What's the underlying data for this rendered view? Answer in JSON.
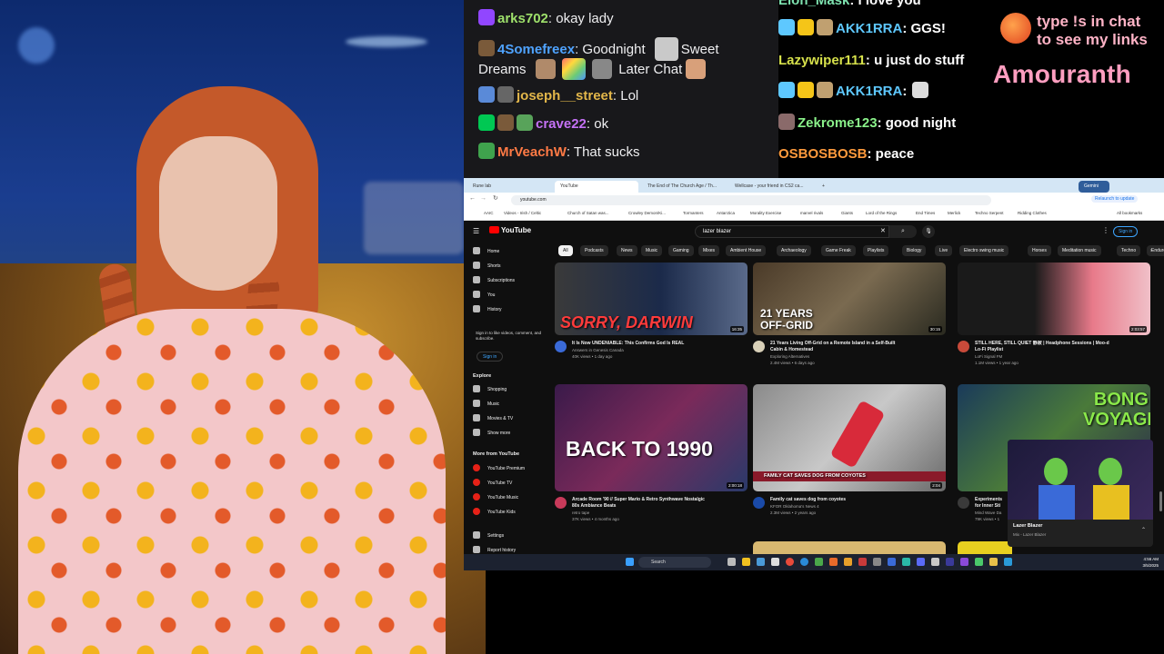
{
  "chat_left": [
    {
      "user": "arks702",
      "text": ": okay lady",
      "color": "#9ee06b"
    },
    {
      "user": "4Somefreex",
      "text": ": Goodnight",
      "extra": "Sweet",
      "color": "#4fa3ff"
    },
    {
      "line": "Dreams",
      "after": "Later Chat"
    },
    {
      "user": "joseph__street",
      "text": ": Lol",
      "color": "#e2b64a"
    },
    {
      "user": "crave22",
      "text": ": ok",
      "color": "#c471f5"
    },
    {
      "user": "MrVeachW",
      "text": ": That sucks",
      "color": "#ff7a45"
    }
  ],
  "chat_right": [
    {
      "user": "Elon_Mask",
      "text": ": i love you",
      "color": "#7ee3b0"
    },
    {
      "user": "AKK1RRA",
      "text": ": GGS!",
      "color": "#5ec8ff"
    },
    {
      "user": "Lazywiper111",
      "text": ": u just do stuff",
      "color": "#d6e04b"
    },
    {
      "user": "AKK1RRA",
      "text": ":",
      "color": "#5ec8ff"
    },
    {
      "user": "Zekrome123",
      "text": ": good night",
      "color": "#8af28a"
    },
    {
      "user": "OSBOSBOSB",
      "text": ": peace",
      "color": "#ff9a3c"
    }
  ],
  "promo": {
    "line1": "type !s in chat",
    "line2": "to see my links",
    "name": "Amouranth"
  },
  "browser": {
    "tabs": [
      "Rune lab",
      "YouTube",
      "The End of The Church Age / Th...",
      "Wellcase - your friend in CS2 ca..."
    ],
    "url": "youtube.com",
    "bookmarks": [
      "AAIC",
      "Videos - Irish / Celtic",
      "Church of Satan was...",
      "Crowley Demon/Ki...",
      "Tormanters",
      "Antarctica",
      "Morality Exercise",
      "marvel rivals",
      "Giants",
      "Lord of the Rings",
      "End Times",
      "Merlick",
      "Techno Serpent",
      "Ridding Clothes",
      "All bookmarks"
    ],
    "tab_extra": "Gemini",
    "update_label": "Relaunch to update"
  },
  "youtube": {
    "logo": "YouTube",
    "search_value": "lazer blazer",
    "signin": "Sign in",
    "chips": [
      "All",
      "Podcasts",
      "News",
      "Music",
      "Gaming",
      "Mixes",
      "Ambient House",
      "Archaeology",
      "Game Freak",
      "Playlists",
      "Biology",
      "Live",
      "Electro swing music",
      "Horses",
      "Meditation music",
      "Techno",
      "Enduro"
    ],
    "sidebar": {
      "main": [
        "Home",
        "Shorts",
        "Subscriptions",
        "You",
        "History"
      ],
      "note": "Sign in to like videos, comment, and subscribe.",
      "signin": "Sign in",
      "explore_head": "Explore",
      "explore": [
        "Shopping",
        "Music",
        "Movies & TV",
        "Show more"
      ],
      "more_head": "More from YouTube",
      "more": [
        "YouTube Premium",
        "YouTube TV",
        "YouTube Music",
        "YouTube Kids"
      ],
      "settings": [
        "Settings",
        "Report history"
      ]
    },
    "videos": [
      {
        "title": "It Is Now UNDENIABLE: This Confirms God Is REAL",
        "channel": "Answers in Genesis Canada",
        "meta": "40K views • 1 day ago",
        "thumb_text": "SORRY, DARWIN",
        "duration": "16:35"
      },
      {
        "title": "21 Years Living Off-Grid on a Remote Island in a Self-Built",
        "title2": "Cabin & Homestead",
        "channel": "Exploring Alternatives",
        "meta": "2.4M views • 6 days ago",
        "thumb_text": "21 YEARS",
        "thumb_text2": "OFF-GRID",
        "duration": "30:15"
      },
      {
        "title": "STILL HERE, STILL QUIET 静寂 | Headphone Sessions | Moo-d",
        "title2": "Lo-Fi Playlist",
        "channel": "LoFi Signal FM",
        "meta": "1.1M views • 1 year ago",
        "duration": "2:03:57"
      },
      {
        "title": "Arcade Room '90 // Super Mario & Retro Synthwave Nostalgic",
        "title2": "80s Ambiance Beats",
        "channel": "retro tape",
        "meta": "37K views • 4 months ago",
        "thumb_text": "BACK TO 1990",
        "duration": "2:00:18"
      },
      {
        "title": "Family cat saves dog from coyotes",
        "channel": "KFOR Oklahoma's News 4",
        "meta": "2.3M views • 2 years ago",
        "thumb_text": "FAMILY CAT SAVES DOG FROM COYOTES",
        "duration": "2:04"
      },
      {
        "title": "Experiments",
        "title2": "for Inner Sti",
        "channel": "Mind Wave Da",
        "meta": "79K views • 1",
        "thumb_text": "BONG",
        "thumb_text2": "VOYAGE"
      }
    ],
    "mini_player": {
      "title": "Lazer Blazer",
      "subtitle": "Mix - Lazer Blazer"
    }
  },
  "taskbar": {
    "search": "Search",
    "time": "4:56 AM",
    "date": "3/5/2025"
  }
}
